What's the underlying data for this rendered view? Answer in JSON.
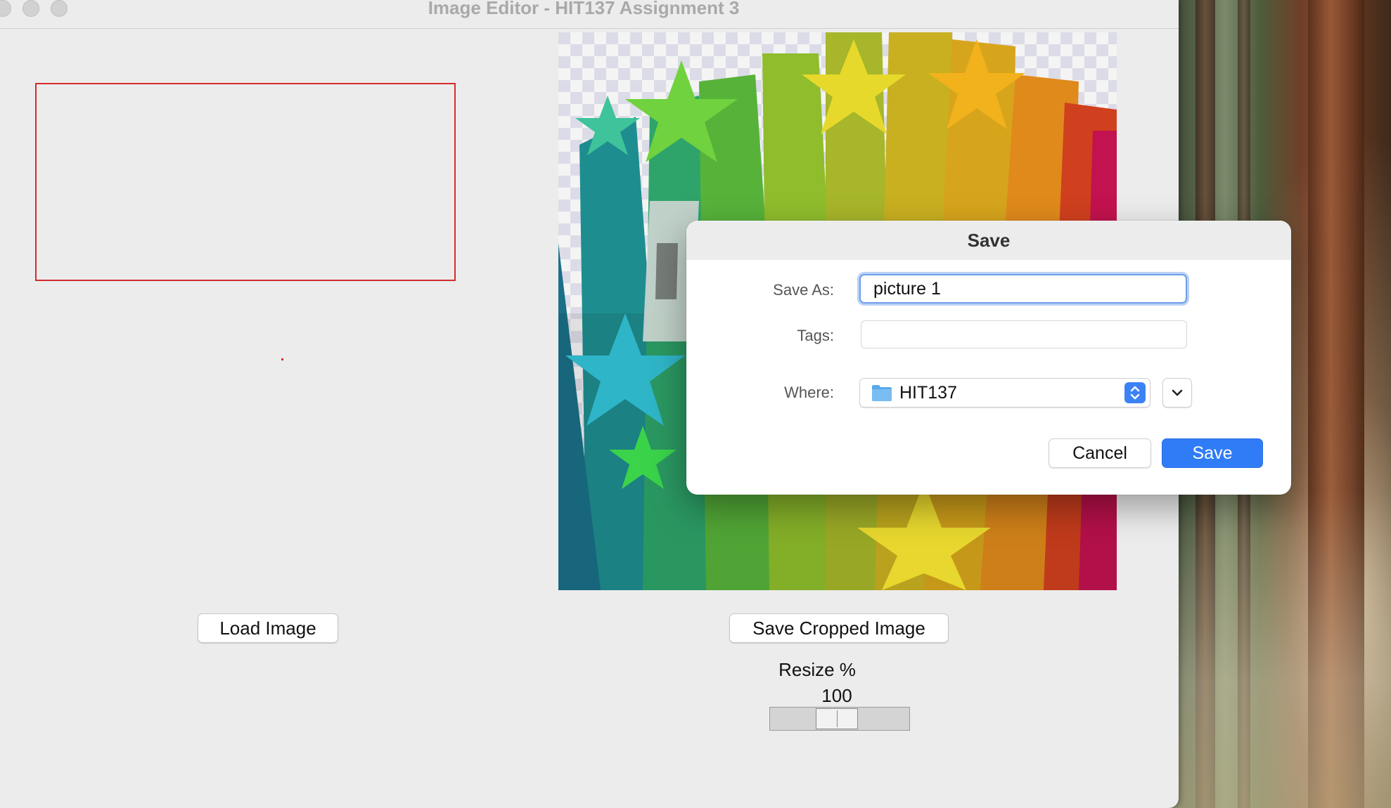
{
  "window": {
    "title": "Image Editor - HIT137 Assignment 3"
  },
  "main": {
    "load_button": "Load Image",
    "save_cropped_button": "Save Cropped Image",
    "resize_label": "Resize %",
    "resize_value": "100",
    "crop_color": "#d42c2c"
  },
  "dialog": {
    "title": "Save",
    "save_as_label": "Save As:",
    "save_as_value": "picture 1",
    "tags_label": "Tags:",
    "tags_value": "",
    "where_label": "Where:",
    "where_value": "HIT137",
    "cancel_button": "Cancel",
    "save_button": "Save",
    "accent_color": "#2f7cf6"
  },
  "icons": {
    "folder": "folder-icon",
    "stepper": "up-down-chevron-icon",
    "expand": "chevron-down-icon"
  }
}
